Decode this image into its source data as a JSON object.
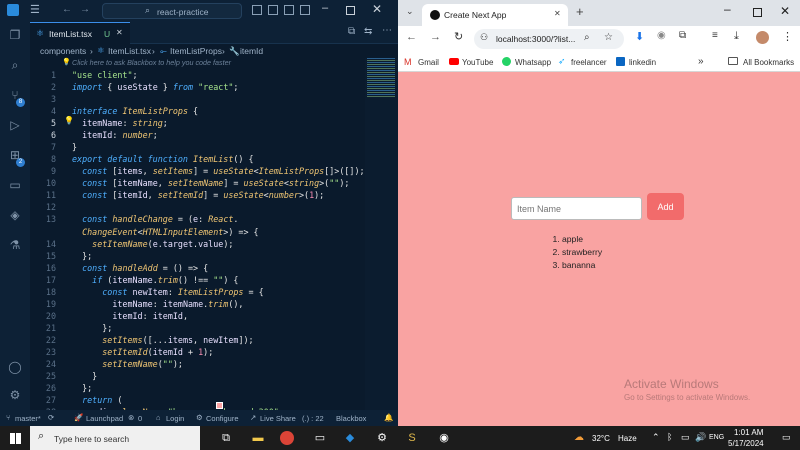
{
  "vscode": {
    "search_text": "react-practice",
    "tab_label": "ItemList.tsx",
    "tab_status": "U",
    "breadcrumb": [
      "components",
      "ItemList.tsx",
      "ItemListProps",
      "itemId"
    ],
    "ai_hint": "Click here to ask Blackbox to help you code faster",
    "badges": {
      "scm": "8",
      "extensions": "2"
    },
    "lines": [
      {
        "n": "1",
        "tokens": [
          [
            "st",
            "\"use client\""
          ],
          [
            "pn",
            ";"
          ]
        ]
      },
      {
        "n": "2",
        "tokens": [
          [
            "kw",
            "import"
          ],
          [
            "pn",
            " { "
          ],
          [
            "vr",
            "useState"
          ],
          [
            "pn",
            " } "
          ],
          [
            "kw",
            "from"
          ],
          [
            "pn",
            " "
          ],
          [
            "st",
            "\"react\""
          ],
          [
            "pn",
            ";"
          ]
        ]
      },
      {
        "n": "3",
        "tokens": []
      },
      {
        "n": "4",
        "tokens": [
          [
            "kw",
            "interface"
          ],
          [
            "pn",
            " "
          ],
          [
            "ty",
            "ItemListProps"
          ],
          [
            "pn",
            " {"
          ]
        ]
      },
      {
        "n": "5",
        "tokens": [
          [
            "pn",
            "  "
          ],
          [
            "vr",
            "itemName"
          ],
          [
            "pn",
            ": "
          ],
          [
            "ty",
            "string"
          ],
          [
            "pn",
            ";"
          ]
        ]
      },
      {
        "n": "6",
        "tokens": [
          [
            "pn",
            "  "
          ],
          [
            "vr",
            "itemId"
          ],
          [
            "pn",
            ": "
          ],
          [
            "ty",
            "number"
          ],
          [
            "pn",
            ";"
          ]
        ]
      },
      {
        "n": "7",
        "tokens": [
          [
            "pn",
            "}"
          ]
        ]
      },
      {
        "n": "8",
        "tokens": [
          [
            "kw",
            "export default function"
          ],
          [
            "pn",
            " "
          ],
          [
            "fn",
            "ItemList"
          ],
          [
            "pn",
            "() {"
          ]
        ]
      },
      {
        "n": "9",
        "tokens": [
          [
            "pn",
            "  "
          ],
          [
            "kw",
            "const"
          ],
          [
            "pn",
            " ["
          ],
          [
            "vr",
            "items"
          ],
          [
            "pn",
            ", "
          ],
          [
            "fn",
            "setItems"
          ],
          [
            "pn",
            "] = "
          ],
          [
            "fn",
            "useState"
          ],
          [
            "pn",
            "<"
          ],
          [
            "ty",
            "ItemListProps"
          ],
          [
            "pn",
            "[]>([]);"
          ]
        ]
      },
      {
        "n": "10",
        "tokens": [
          [
            "pn",
            "  "
          ],
          [
            "kw",
            "const"
          ],
          [
            "pn",
            " ["
          ],
          [
            "vr",
            "itemName"
          ],
          [
            "pn",
            ", "
          ],
          [
            "fn",
            "setItemName"
          ],
          [
            "pn",
            "] = "
          ],
          [
            "fn",
            "useState"
          ],
          [
            "pn",
            "<"
          ],
          [
            "ty",
            "string"
          ],
          [
            "pn",
            ">("
          ],
          [
            "st",
            "\"\""
          ],
          [
            "pn",
            ");"
          ]
        ]
      },
      {
        "n": "11",
        "tokens": [
          [
            "pn",
            "  "
          ],
          [
            "kw",
            "const"
          ],
          [
            "pn",
            " ["
          ],
          [
            "vr",
            "itemId"
          ],
          [
            "pn",
            ", "
          ],
          [
            "fn",
            "setItemId"
          ],
          [
            "pn",
            "] = "
          ],
          [
            "fn",
            "useState"
          ],
          [
            "pn",
            "<"
          ],
          [
            "ty",
            "number"
          ],
          [
            "pn",
            ">("
          ],
          [
            "nm",
            "1"
          ],
          [
            "pn",
            ");"
          ]
        ]
      },
      {
        "n": "12",
        "tokens": []
      },
      {
        "n": "13",
        "tokens": [
          [
            "pn",
            "  "
          ],
          [
            "kw",
            "const"
          ],
          [
            "pn",
            " "
          ],
          [
            "fn",
            "handleChange"
          ],
          [
            "pn",
            " = ("
          ],
          [
            "vr",
            "e"
          ],
          [
            "pn",
            ": "
          ],
          [
            "ty",
            "React"
          ],
          [
            "pn",
            "."
          ]
        ]
      },
      {
        "n": "",
        "tokens": [
          [
            "pn",
            "  "
          ],
          [
            "ty",
            "ChangeEvent"
          ],
          [
            "pn",
            "<"
          ],
          [
            "ty",
            "HTMLInputElement"
          ],
          [
            "pn",
            ">) => {"
          ]
        ]
      },
      {
        "n": "14",
        "tokens": [
          [
            "pn",
            "    "
          ],
          [
            "fn",
            "setItemName"
          ],
          [
            "pn",
            "("
          ],
          [
            "vr",
            "e"
          ],
          [
            "pn",
            "."
          ],
          [
            "vr",
            "target"
          ],
          [
            "pn",
            "."
          ],
          [
            "vr",
            "value"
          ],
          [
            "pn",
            ");"
          ]
        ]
      },
      {
        "n": "15",
        "tokens": [
          [
            "pn",
            "  };"
          ]
        ]
      },
      {
        "n": "16",
        "tokens": [
          [
            "pn",
            "  "
          ],
          [
            "kw",
            "const"
          ],
          [
            "pn",
            " "
          ],
          [
            "fn",
            "handleAdd"
          ],
          [
            "pn",
            " = () => {"
          ]
        ]
      },
      {
        "n": "17",
        "tokens": [
          [
            "pn",
            "    "
          ],
          [
            "kw",
            "if"
          ],
          [
            "pn",
            " ("
          ],
          [
            "vr",
            "itemName"
          ],
          [
            "pn",
            "."
          ],
          [
            "fn",
            "trim"
          ],
          [
            "pn",
            "() !== "
          ],
          [
            "st",
            "\"\""
          ],
          [
            "pn",
            ") {"
          ]
        ]
      },
      {
        "n": "18",
        "tokens": [
          [
            "pn",
            "      "
          ],
          [
            "kw",
            "const"
          ],
          [
            "pn",
            " "
          ],
          [
            "vr",
            "newItem"
          ],
          [
            "pn",
            ": "
          ],
          [
            "ty",
            "ItemListProps"
          ],
          [
            "pn",
            " = {"
          ]
        ]
      },
      {
        "n": "19",
        "tokens": [
          [
            "pn",
            "        "
          ],
          [
            "vr",
            "itemName"
          ],
          [
            "pn",
            ": "
          ],
          [
            "vr",
            "itemName"
          ],
          [
            "pn",
            "."
          ],
          [
            "fn",
            "trim"
          ],
          [
            "pn",
            "(),"
          ]
        ]
      },
      {
        "n": "20",
        "tokens": [
          [
            "pn",
            "        "
          ],
          [
            "vr",
            "itemId"
          ],
          [
            "pn",
            ": "
          ],
          [
            "vr",
            "itemId"
          ],
          [
            "pn",
            ","
          ]
        ]
      },
      {
        "n": "21",
        "tokens": [
          [
            "pn",
            "      };"
          ]
        ]
      },
      {
        "n": "22",
        "tokens": [
          [
            "pn",
            "      "
          ],
          [
            "fn",
            "setItems"
          ],
          [
            "pn",
            "([..."
          ],
          [
            "vr",
            "items"
          ],
          [
            "pn",
            ", "
          ],
          [
            "vr",
            "newItem"
          ],
          [
            "pn",
            "]);"
          ]
        ]
      },
      {
        "n": "23",
        "tokens": [
          [
            "pn",
            "      "
          ],
          [
            "fn",
            "setItemId"
          ],
          [
            "pn",
            "("
          ],
          [
            "vr",
            "itemId"
          ],
          [
            "pn",
            " + "
          ],
          [
            "nm",
            "1"
          ],
          [
            "pn",
            ");"
          ]
        ]
      },
      {
        "n": "24",
        "tokens": [
          [
            "pn",
            "      "
          ],
          [
            "fn",
            "setItemName"
          ],
          [
            "pn",
            "("
          ],
          [
            "st",
            "\"\""
          ],
          [
            "pn",
            ");"
          ]
        ]
      },
      {
        "n": "25",
        "tokens": [
          [
            "pn",
            "    }"
          ]
        ]
      },
      {
        "n": "26",
        "tokens": [
          [
            "pn",
            "  };"
          ]
        ]
      },
      {
        "n": "27",
        "tokens": [
          [
            "pn",
            "  "
          ],
          [
            "kw",
            "return"
          ],
          [
            "pn",
            " ("
          ]
        ]
      },
      {
        "n": "28",
        "tokens": [
          [
            "pn",
            "    <"
          ],
          [
            "vr",
            "div"
          ],
          [
            "pn",
            " "
          ],
          [
            "pr",
            "className"
          ],
          [
            "pn",
            "="
          ],
          [
            "st",
            "\"h-screen  "
          ],
          [
            "st",
            "bg-red-300\""
          ],
          [
            "pn",
            ">"
          ]
        ]
      }
    ],
    "status": {
      "branch": "master*",
      "launchpad": "Launchpad",
      "errors": "0",
      "login": "Login",
      "configure": "Configure",
      "liveshare": "Live Share",
      "position": "(.) : 22",
      "blackbox": "Blackbox"
    }
  },
  "chrome": {
    "tab_title": "Create Next App",
    "url": "localhost:3000/?list...",
    "bookmarks": [
      "Gmail",
      "YouTube",
      "Whatsapp",
      "freelancer",
      "linkedin"
    ],
    "all_bookmarks": "All Bookmarks",
    "page": {
      "input_placeholder": "Item Name",
      "add_button": "Add",
      "items": [
        "apple",
        "strawberry",
        "bananna"
      ]
    },
    "watermark_title": "Activate Windows",
    "watermark_sub": "Go to Settings to activate Windows."
  },
  "taskbar": {
    "search_placeholder": "Type here to search",
    "weather_temp": "32°C",
    "weather_desc": "Haze",
    "lang": "ENG",
    "time": "1:01 AM",
    "date": "5/17/2024"
  },
  "colors": {
    "vscode_bg": "#0a1a2c",
    "page_bg": "#f9a3a2",
    "button_bg": "#f26b6b",
    "chrome_accent": "#1a73e8"
  }
}
